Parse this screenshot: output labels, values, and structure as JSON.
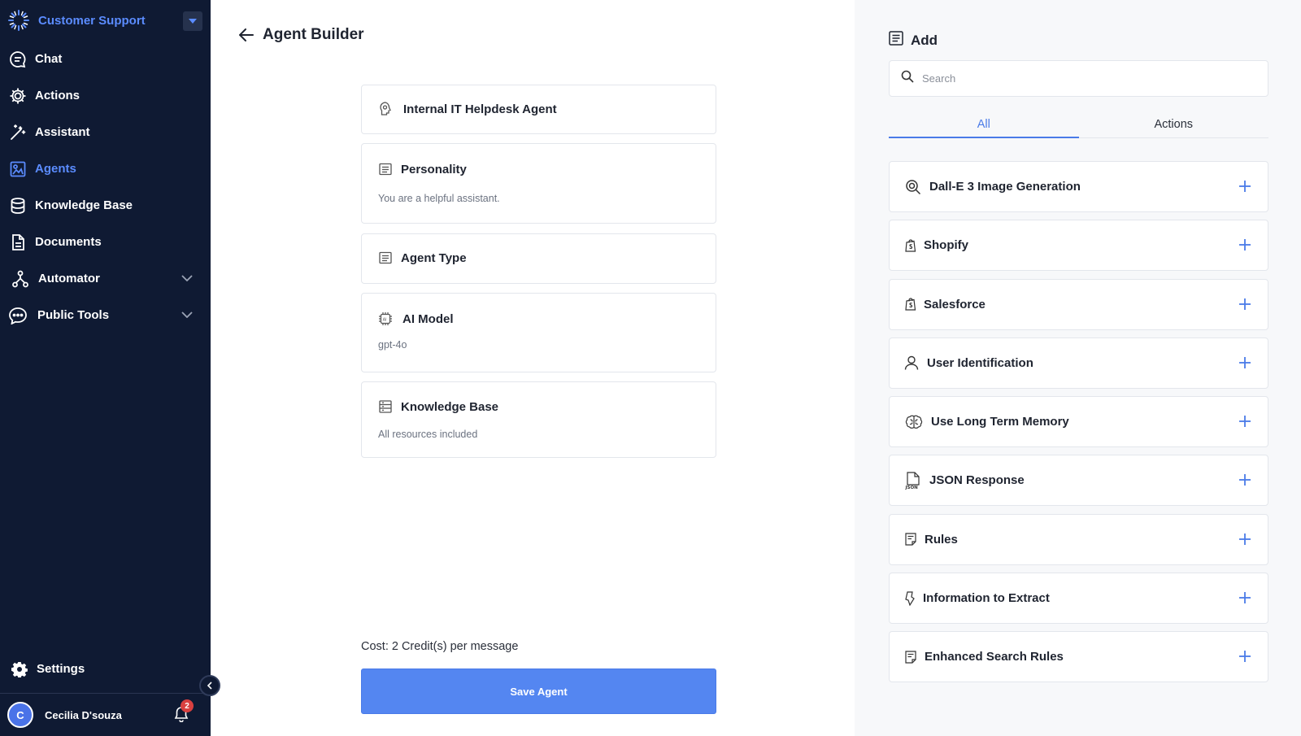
{
  "sidebar": {
    "workspace_name": "Customer Support",
    "nav": [
      {
        "label": "Chat",
        "icon": "chat-icon"
      },
      {
        "label": "Actions",
        "icon": "gear-icon"
      },
      {
        "label": "Assistant",
        "icon": "magic-wand-icon"
      },
      {
        "label": "Agents",
        "icon": "agents-icon",
        "active": true
      },
      {
        "label": "Knowledge Base",
        "icon": "database-icon"
      },
      {
        "label": "Documents",
        "icon": "document-icon"
      },
      {
        "label": "Automator",
        "icon": "workflow-icon",
        "expandable": true
      },
      {
        "label": "Public Tools",
        "icon": "chat-bubble-dots-icon",
        "expandable": true
      }
    ],
    "settings_label": "Settings",
    "user": {
      "initial": "C",
      "name": "Cecilia D'souza",
      "notifications": "2"
    }
  },
  "main": {
    "title": "Agent Builder",
    "agent_name": "Internal IT Helpdesk Agent",
    "sections": {
      "personality": {
        "title": "Personality",
        "value": "You are a helpful assistant."
      },
      "agent_type": {
        "title": "Agent Type"
      },
      "ai_model": {
        "title": "AI Model",
        "value": "gpt-4o"
      },
      "knowledge_base": {
        "title": "Knowledge Base",
        "value": "All resources included"
      }
    },
    "cost": "Cost: 2 Credit(s) per message",
    "save_label": "Save Agent"
  },
  "panel": {
    "title": "Add",
    "search_placeholder": "Search",
    "tabs": [
      {
        "label": "All",
        "active": true
      },
      {
        "label": "Actions"
      }
    ],
    "items": [
      {
        "label": "Dall-E 3 Image Generation",
        "icon": "image-search-icon"
      },
      {
        "label": "Shopify",
        "icon": "shopify-icon"
      },
      {
        "label": "Salesforce",
        "icon": "salesforce-icon"
      },
      {
        "label": "User Identification",
        "icon": "user-icon"
      },
      {
        "label": "Use Long Term Memory",
        "icon": "brain-icon"
      },
      {
        "label": "JSON Response",
        "icon": "json-file-icon"
      },
      {
        "label": "Rules",
        "icon": "rules-icon"
      },
      {
        "label": "Information to Extract",
        "icon": "extract-icon"
      },
      {
        "label": "Enhanced Search Rules",
        "icon": "rules-icon"
      }
    ]
  },
  "colors": {
    "sidebar_bg": "#0f1a33",
    "accent": "#5b8cff",
    "button": "#5486f1",
    "panel_bg": "#f7f8fa"
  }
}
